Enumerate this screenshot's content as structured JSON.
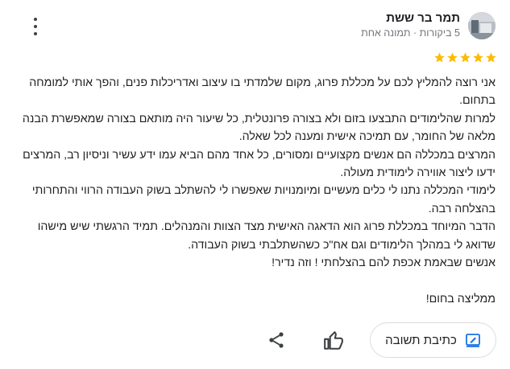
{
  "reviewer": {
    "name": "תמר בר ששת",
    "meta": "5 ביקורות · תמונה אחת"
  },
  "rating": {
    "stars": 5,
    "max": 5,
    "color": "#fbbc04"
  },
  "review_paragraphs": [
    "אני רוצה להמליץ לכם על מכללת פרוג, מקום שלמדתי בו עיצוב ואדריכלות פנים, והפך אותי למומחה בתחום.",
    "למרות שהלימודים התבצעו בזום ולא בצורה פרונטלית, כל שיעור היה מותאם בצורה שמאפשרת הבנה מלאה של החומר, עם תמיכה אישית ומענה לכל שאלה.",
    "המרצים במכללה הם אנשים מקצועיים ומסורים, כל אחד מהם הביא עמו ידע עשיר וניסיון רב, המרצים ידעו ליצור אווירה לימודית מעולה.",
    "לימודי המכללה נתנו לי כלים מעשיים ומיומנויות שאפשרו לי להשתלב בשוק העבודה הרווי והתחרותי בהצלחה רבה.",
    "הדבר המיוחד במכללת פרוג הוא הדאגה האישית מצד הצוות והמנהלים. תמיד הרגשתי שיש מישהו שדואג לי במהלך הלימודים וגם אח\"כ כשהשתלבתי בשוק העבודה.",
    "אנשים שבאמת אכפת להם בהצלחתי ! וזה נדיר!",
    "",
    "ממליצה בחום!"
  ],
  "actions": {
    "reply_label": "כתיבת תשובה",
    "reply_icon": "edit-reply-icon",
    "like_icon": "thumbs-up-icon",
    "share_icon": "share-icon",
    "more_icon": "more-vert-icon"
  }
}
